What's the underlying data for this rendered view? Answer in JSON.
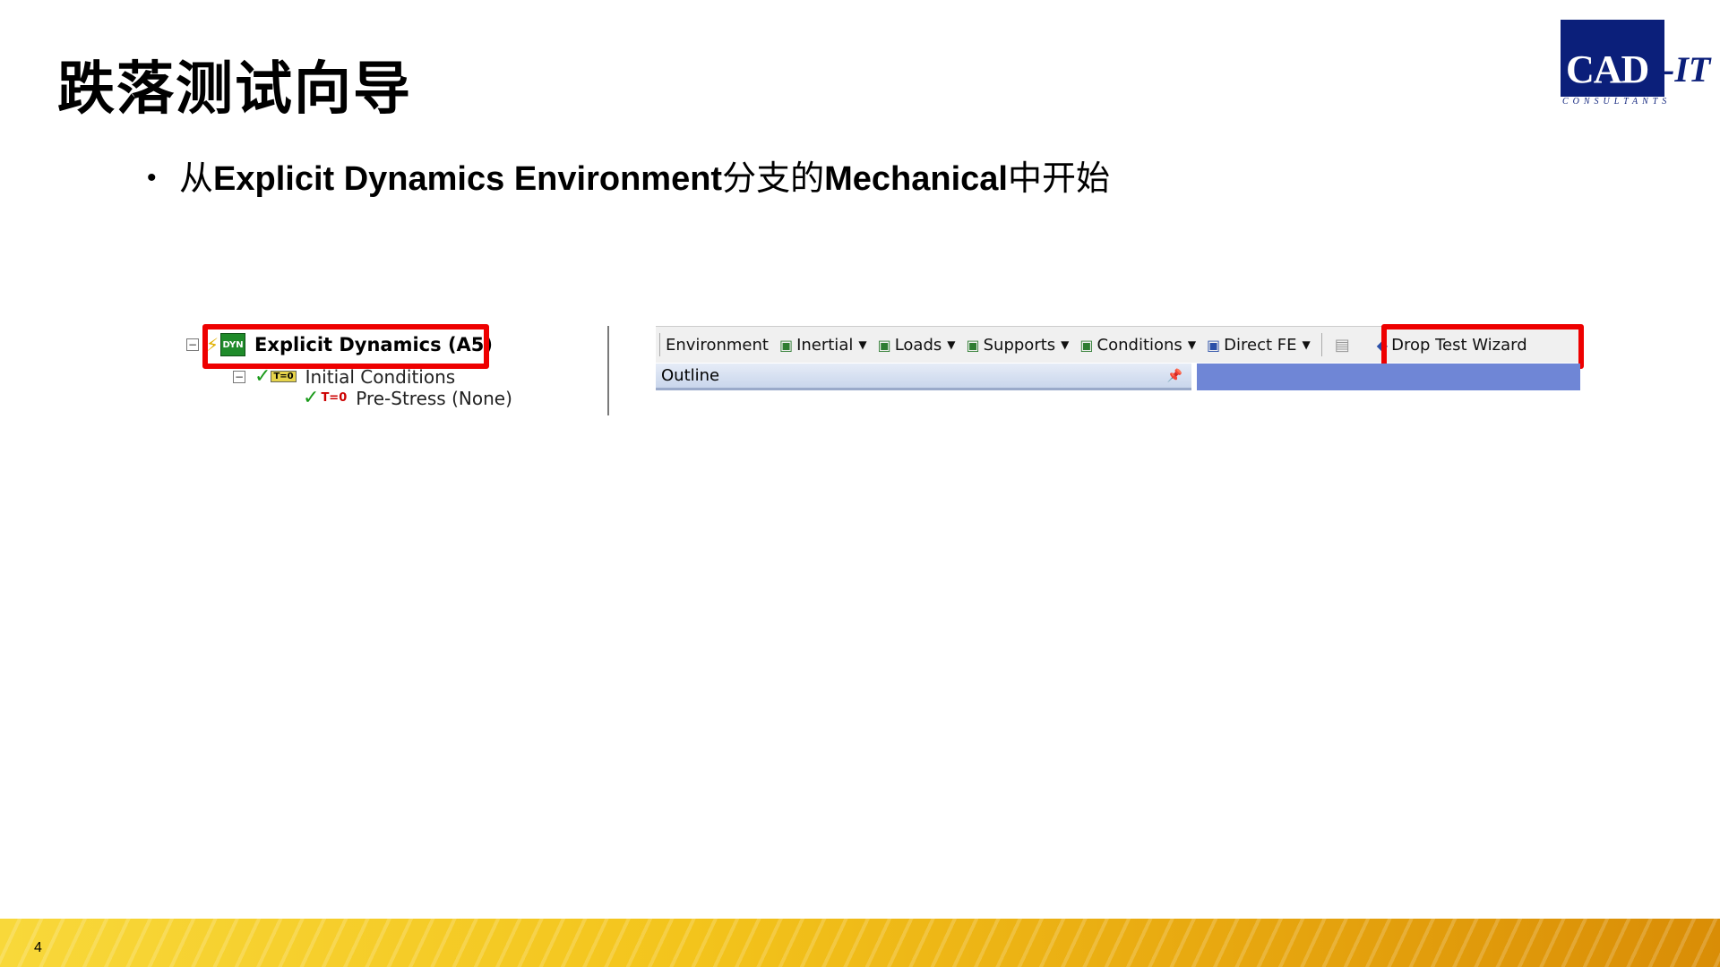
{
  "slide": {
    "title": "跌落测试向导",
    "bullet": {
      "prefix": "从",
      "term1": "Explicit Dynamics Environment",
      "mid": "分支的",
      "term2": "Mechanical",
      "suffix": "中开始"
    },
    "page_number": "4"
  },
  "logo": {
    "main": "CAD",
    "accent": "-IT",
    "sub": "CONSULTANTS"
  },
  "tree": {
    "root_label": "Explicit Dynamics (A5)",
    "root_icon_text": "DYN",
    "child1_label": "Initial Conditions",
    "child1_icon_text": "T=0",
    "child2_label": "Pre-Stress (None)",
    "child2_icon_text": "T=0",
    "minus_glyph": "−"
  },
  "toolbar": {
    "items": [
      "Environment",
      "Inertial",
      "Loads",
      "Supports",
      "Conditions",
      "Direct FE"
    ],
    "wizard_label": "Drop Test Wizard"
  },
  "outline": {
    "label": "Outline",
    "pin_glyph": "📌"
  },
  "colors": {
    "highlight": "#ee0000",
    "logo_blue": "#0b1f7a",
    "footer_yellow": "#f3c41c"
  }
}
